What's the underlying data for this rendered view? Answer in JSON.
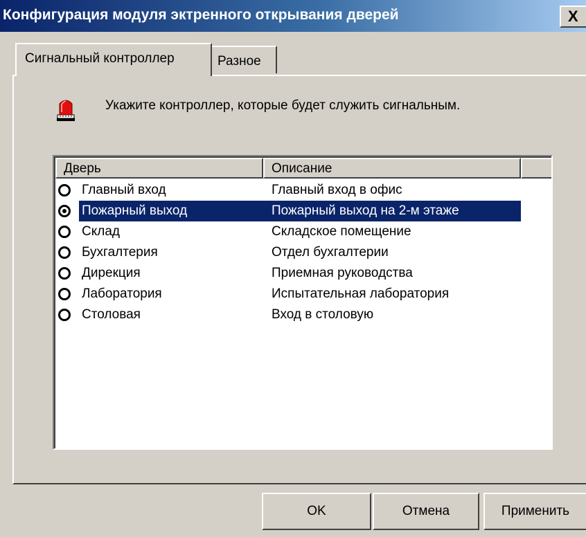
{
  "window": {
    "title": "Конфигурация модуля эктренного открывания дверей",
    "close_glyph": "X"
  },
  "tabs": [
    {
      "label": "Сигнальный контроллер",
      "active": true
    },
    {
      "label": "Разное",
      "active": false
    }
  ],
  "instruction": {
    "icon": "alarm-beacon-icon",
    "text": "Укажите контроллер, которые будет служить сигнальным."
  },
  "list": {
    "columns": [
      "Дверь",
      "Описание",
      ""
    ],
    "rows": [
      {
        "door": "Главный вход",
        "description": "Главный вход в офис",
        "checked": false
      },
      {
        "door": "Пожарный выход",
        "description": "Пожарный выход на 2-м этаже",
        "checked": true
      },
      {
        "door": "Склад",
        "description": "Складское помещение",
        "checked": false
      },
      {
        "door": "Бухгалтерия",
        "description": "Отдел бухгалтерии",
        "checked": false
      },
      {
        "door": "Дирекция",
        "description": "Приемная руководства",
        "checked": false
      },
      {
        "door": "Лаборатория",
        "description": "Испытательная лаборатория",
        "checked": false
      },
      {
        "door": "Столовая",
        "description": "Вход в столовую",
        "checked": false
      }
    ]
  },
  "buttons": {
    "ok": "OK",
    "cancel": "Отмена",
    "apply": "Применить"
  },
  "colors": {
    "selection": "#0a246a",
    "face": "#d4d0c8",
    "alarm": "#e01010"
  }
}
